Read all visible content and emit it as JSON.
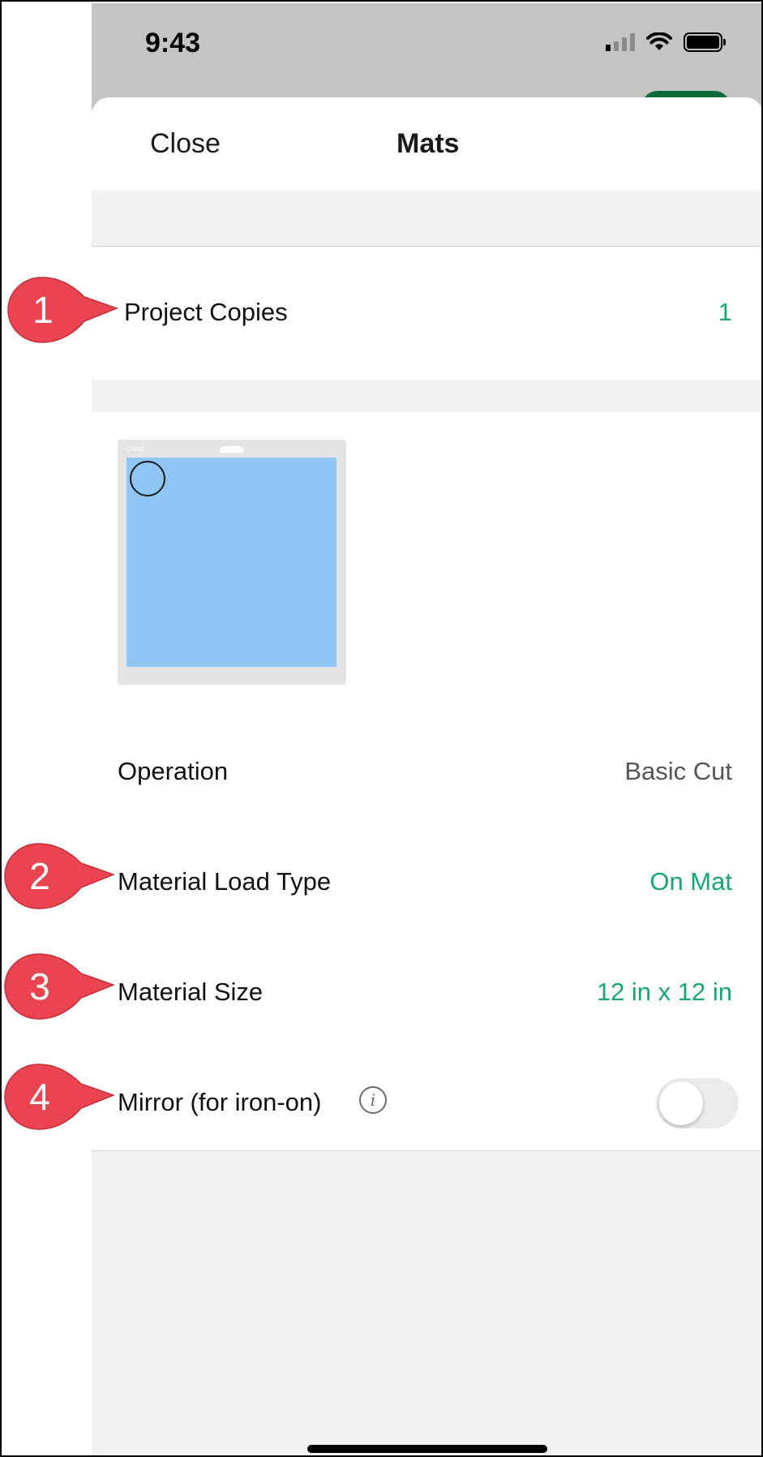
{
  "status_bar": {
    "time": "9:43"
  },
  "sheet": {
    "close_label": "Close",
    "title": "Mats"
  },
  "project_copies": {
    "label": "Project Copies",
    "value": "1"
  },
  "mat": {
    "brand": "cricut",
    "material_color": "#90c6f4"
  },
  "settings": {
    "operation": {
      "label": "Operation",
      "value": "Basic Cut"
    },
    "load_type": {
      "label": "Material Load Type",
      "value": "On Mat"
    },
    "size": {
      "label": "Material Size",
      "value": "12 in x 12 in"
    },
    "mirror": {
      "label": "Mirror (for iron-on)",
      "info_icon": "i",
      "enabled": false
    }
  },
  "callouts": [
    "1",
    "2",
    "3",
    "4"
  ],
  "colors": {
    "accent": "#18a672",
    "callout": "#e9444f",
    "brand_button": "#0f6b3c"
  }
}
